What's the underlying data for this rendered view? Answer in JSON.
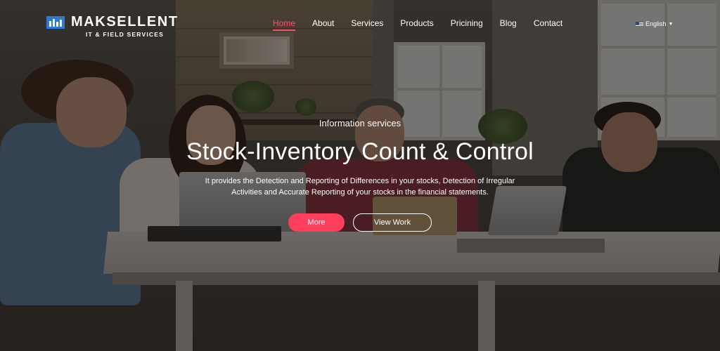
{
  "brand": {
    "name": "MAKSELLENT",
    "tagline": "IT & FIELD SERVICES"
  },
  "nav": {
    "items": [
      {
        "label": "Home",
        "active": true
      },
      {
        "label": "About"
      },
      {
        "label": "Services"
      },
      {
        "label": "Products"
      },
      {
        "label": "Pricining"
      },
      {
        "label": "Blog"
      },
      {
        "label": "Contact"
      }
    ],
    "language": "English"
  },
  "hero": {
    "eyebrow": "Information services",
    "title": "Stock-Inventory Count & Control",
    "description_line1": "It provides the Detection and Reporting of Differences in your stocks, Detection of Irregular",
    "description_line2": "Activities and Accurate Reporting of your stocks in the financial statements.",
    "primary_button": "More",
    "secondary_button": "View Work"
  },
  "colors": {
    "accent": "#ff3d5c",
    "brand_blue": "#2d7bd0"
  }
}
